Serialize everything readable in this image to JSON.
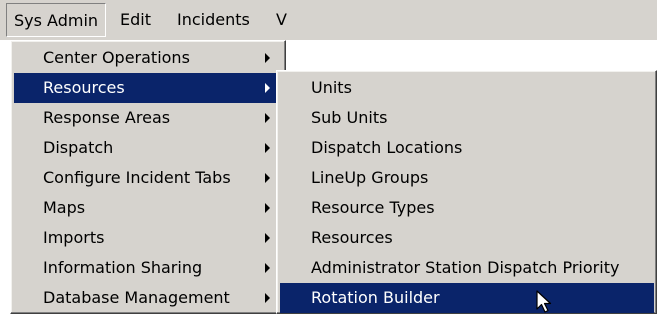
{
  "menubar": {
    "items": [
      {
        "label": "Sys Admin",
        "active": true
      },
      {
        "label": "Edit",
        "active": false
      },
      {
        "label": "Incidents",
        "active": false
      },
      {
        "label": "V",
        "active": false
      }
    ]
  },
  "main_menu": {
    "items": [
      {
        "label": "Center Operations",
        "submenu": true,
        "highlighted": false
      },
      {
        "label": "Resources",
        "submenu": true,
        "highlighted": true
      },
      {
        "label": "Response Areas",
        "submenu": true,
        "highlighted": false
      },
      {
        "label": "Dispatch",
        "submenu": true,
        "highlighted": false
      },
      {
        "label": "Configure Incident Tabs",
        "submenu": true,
        "highlighted": false
      },
      {
        "label": "Maps",
        "submenu": true,
        "highlighted": false
      },
      {
        "label": "Imports",
        "submenu": true,
        "highlighted": false
      },
      {
        "label": "Information Sharing",
        "submenu": true,
        "highlighted": false
      },
      {
        "label": "Database Management",
        "submenu": true,
        "highlighted": false
      }
    ]
  },
  "resources_submenu": {
    "items": [
      {
        "label": "Units",
        "highlighted": false
      },
      {
        "label": "Sub Units",
        "highlighted": false
      },
      {
        "label": "Dispatch Locations",
        "highlighted": false
      },
      {
        "label": "LineUp Groups",
        "highlighted": false
      },
      {
        "label": "Resource Types",
        "highlighted": false
      },
      {
        "label": "Resources",
        "highlighted": false
      },
      {
        "label": "Administrator Station Dispatch Priority",
        "highlighted": false
      },
      {
        "label": "Rotation Builder",
        "highlighted": true
      }
    ]
  },
  "colors": {
    "menu_bg": "#d6d3ce",
    "highlight_bg": "#0a246a",
    "highlight_text": "#ffffff"
  },
  "icons": {
    "submenu_arrow": "chevron-right-icon",
    "cursor": "mouse-pointer-icon"
  }
}
